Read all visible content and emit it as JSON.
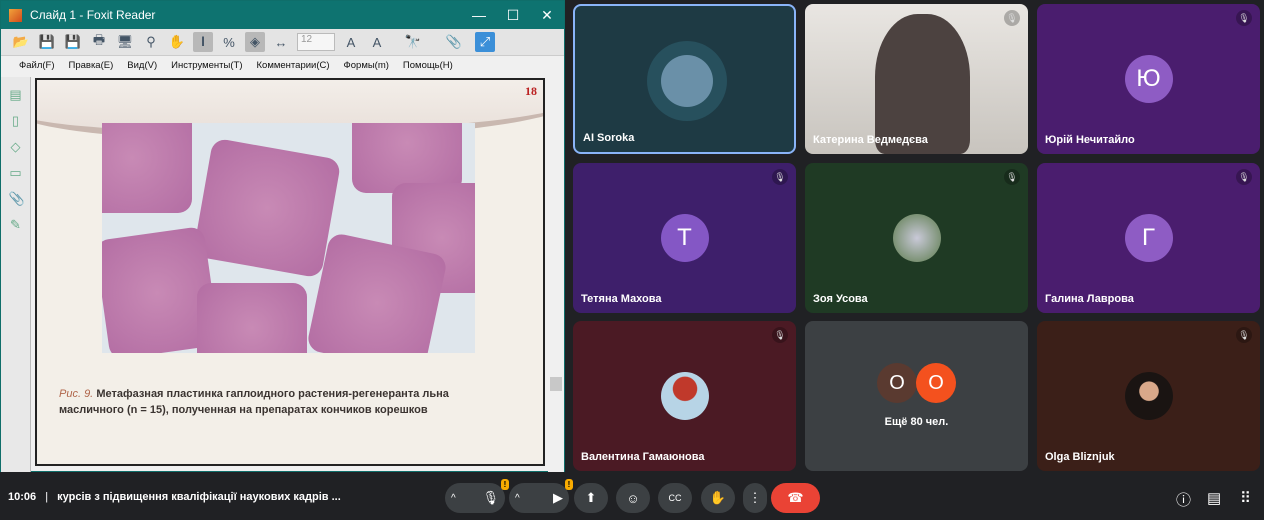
{
  "foxit": {
    "title": "Слайд 1 - Foxit Reader",
    "font_size": "12",
    "menu": [
      "Файл(F)",
      "Правка(E)",
      "Вид(V)",
      "Инструменты(T)",
      "Комментарии(C)",
      "Формы(m)",
      "Помощь(H)"
    ],
    "page_number": "18",
    "caption_label": "Рис. 9.",
    "caption_text": "Метафазная пластинка гаплоидного растения-регенеранта льна масличного (n = 15), полученная на препаратах кончиков корешков"
  },
  "participants": [
    {
      "name": "AI Soroka",
      "color": "#1e3a44",
      "avatar": "photo",
      "muted": false
    },
    {
      "name": "Катерина Ведмедєва",
      "color": "#8a8680",
      "avatar": "video",
      "muted": true
    },
    {
      "name": "Юрій Нечитайло",
      "color": "#4a1d6e",
      "avatar": "Ю",
      "muted": true
    },
    {
      "name": "Тетяна Махова",
      "color": "#3e1f6b",
      "avatar": "Т",
      "muted": true
    },
    {
      "name": "Зоя Усова",
      "color": "#1f3a24",
      "avatar": "photo",
      "muted": true
    },
    {
      "name": "Галина Лаврова",
      "color": "#4a1d6e",
      "avatar": "Г",
      "muted": true
    },
    {
      "name": "Валентина Гамаюнова",
      "color": "#4b1a24",
      "avatar": "photo",
      "muted": true
    },
    {
      "name": "Olga Bliznjuk",
      "color": "#3b1f18",
      "avatar": "photo",
      "muted": true
    }
  ],
  "more": {
    "label": "Ещё 80 чел.",
    "avatars": [
      "О",
      "О"
    ]
  },
  "meeting": {
    "time": "10:06",
    "separator": "|",
    "title": "курсів з підвищення кваліфікації наукових кадрів ..."
  }
}
